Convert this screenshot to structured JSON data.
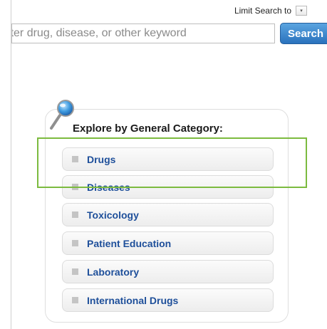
{
  "limit_search": {
    "label": "Limit Search to",
    "dropdown_arrow": "▾"
  },
  "search": {
    "placeholder": "Enter drug, disease, or other keyword",
    "button_label": "Search"
  },
  "explore": {
    "title": "Explore by General Category:",
    "items": [
      {
        "label": "Drugs"
      },
      {
        "label": "Diseases"
      },
      {
        "label": "Toxicology"
      },
      {
        "label": "Patient Education"
      },
      {
        "label": "Laboratory"
      },
      {
        "label": "International Drugs"
      }
    ]
  },
  "colors": {
    "link_blue": "#1e4f9a",
    "search_button": "#2a72bd",
    "highlight_green": "#7cbb3f"
  },
  "icons": {
    "magnifier": "magnifier-icon",
    "bullet": "square-bullet-icon"
  }
}
